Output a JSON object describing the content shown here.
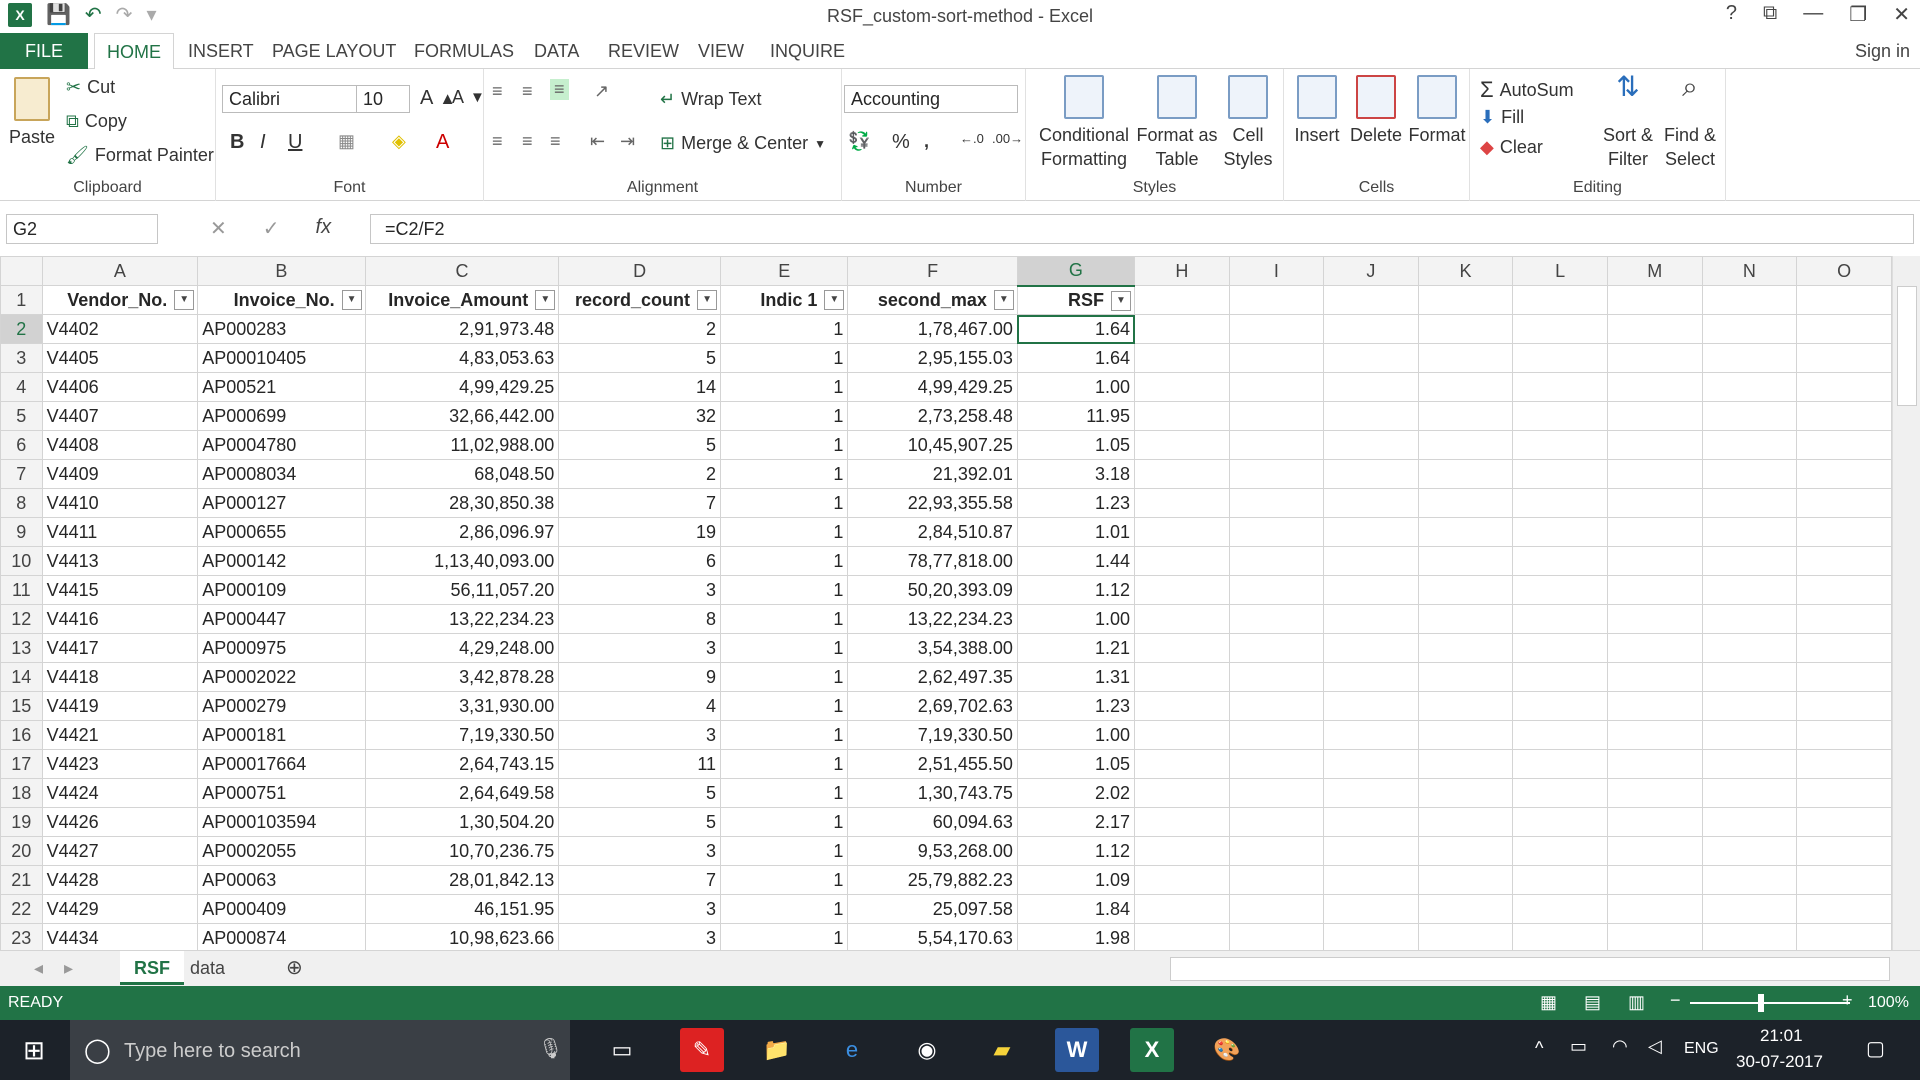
{
  "window": {
    "title": "RSF_custom-sort-method - Excel",
    "sign_in": "Sign in"
  },
  "tabs": [
    "FILE",
    "HOME",
    "INSERT",
    "PAGE LAYOUT",
    "FORMULAS",
    "DATA",
    "REVIEW",
    "VIEW",
    "INQUIRE"
  ],
  "ribbon": {
    "clipboard": {
      "label": "Clipboard",
      "paste": "Paste",
      "cut": "Cut",
      "copy": "Copy",
      "format_painter": "Format Painter"
    },
    "font": {
      "label": "Font",
      "name": "Calibri",
      "size": "10"
    },
    "alignment": {
      "label": "Alignment",
      "wrap": "Wrap Text",
      "merge": "Merge & Center"
    },
    "number": {
      "label": "Number",
      "format": "Accounting"
    },
    "styles": {
      "label": "Styles",
      "conditional": "Conditional",
      "conditional2": "Formatting",
      "format_as": "Format as",
      "format_as2": "Table",
      "cell": "Cell",
      "cell2": "Styles"
    },
    "cells": {
      "label": "Cells",
      "insert": "Insert",
      "delete": "Delete",
      "format": "Format"
    },
    "editing": {
      "label": "Editing",
      "autosum": "AutoSum",
      "fill": "Fill",
      "clear": "Clear",
      "sort": "Sort &",
      "sort2": "Filter",
      "find": "Find &",
      "find2": "Select"
    }
  },
  "formula_bar": {
    "name_box": "G2",
    "formula": "=C2/F2"
  },
  "columns": [
    "A",
    "B",
    "C",
    "D",
    "E",
    "F",
    "G",
    "H",
    "I",
    "J",
    "K",
    "L",
    "M",
    "N",
    "O"
  ],
  "headers": [
    "Vendor_No.",
    "Invoice_No.",
    "Invoice_Amount",
    "record_count",
    "Indic 1",
    "second_max",
    "RSF"
  ],
  "rows": [
    [
      "V4402",
      "AP000283",
      "2,91,973.48",
      "2",
      "1",
      "1,78,467.00",
      "1.64"
    ],
    [
      "V4405",
      "AP00010405",
      "4,83,053.63",
      "5",
      "1",
      "2,95,155.03",
      "1.64"
    ],
    [
      "V4406",
      "AP00521",
      "4,99,429.25",
      "14",
      "1",
      "4,99,429.25",
      "1.00"
    ],
    [
      "V4407",
      "AP000699",
      "32,66,442.00",
      "32",
      "1",
      "2,73,258.48",
      "11.95"
    ],
    [
      "V4408",
      "AP0004780",
      "11,02,988.00",
      "5",
      "1",
      "10,45,907.25",
      "1.05"
    ],
    [
      "V4409",
      "AP0008034",
      "68,048.50",
      "2",
      "1",
      "21,392.01",
      "3.18"
    ],
    [
      "V4410",
      "AP000127",
      "28,30,850.38",
      "7",
      "1",
      "22,93,355.58",
      "1.23"
    ],
    [
      "V4411",
      "AP000655",
      "2,86,096.97",
      "19",
      "1",
      "2,84,510.87",
      "1.01"
    ],
    [
      "V4413",
      "AP000142",
      "1,13,40,093.00",
      "6",
      "1",
      "78,77,818.00",
      "1.44"
    ],
    [
      "V4415",
      "AP000109",
      "56,11,057.20",
      "3",
      "1",
      "50,20,393.09",
      "1.12"
    ],
    [
      "V4416",
      "AP000447",
      "13,22,234.23",
      "8",
      "1",
      "13,22,234.23",
      "1.00"
    ],
    [
      "V4417",
      "AP000975",
      "4,29,248.00",
      "3",
      "1",
      "3,54,388.00",
      "1.21"
    ],
    [
      "V4418",
      "AP0002022",
      "3,42,878.28",
      "9",
      "1",
      "2,62,497.35",
      "1.31"
    ],
    [
      "V4419",
      "AP000279",
      "3,31,930.00",
      "4",
      "1",
      "2,69,702.63",
      "1.23"
    ],
    [
      "V4421",
      "AP000181",
      "7,19,330.50",
      "3",
      "1",
      "7,19,330.50",
      "1.00"
    ],
    [
      "V4423",
      "AP00017664",
      "2,64,743.15",
      "11",
      "1",
      "2,51,455.50",
      "1.05"
    ],
    [
      "V4424",
      "AP000751",
      "2,64,649.58",
      "5",
      "1",
      "1,30,743.75",
      "2.02"
    ],
    [
      "V4426",
      "AP000103594",
      "1,30,504.20",
      "5",
      "1",
      "60,094.63",
      "2.17"
    ],
    [
      "V4427",
      "AP0002055",
      "10,70,236.75",
      "3",
      "1",
      "9,53,268.00",
      "1.12"
    ],
    [
      "V4428",
      "AP00063",
      "28,01,842.13",
      "7",
      "1",
      "25,79,882.23",
      "1.09"
    ],
    [
      "V4429",
      "AP000409",
      "46,151.95",
      "3",
      "1",
      "25,097.58",
      "1.84"
    ],
    [
      "V4434",
      "AP000874",
      "10,98,623.66",
      "3",
      "1",
      "5,54,170.63",
      "1.98"
    ]
  ],
  "sheets": [
    "RSF",
    "data"
  ],
  "status": {
    "mode": "READY",
    "zoom": "100%"
  },
  "taskbar": {
    "search": "Type here to search",
    "lang": "ENG",
    "time": "21:01",
    "date": "30-07-2017"
  }
}
